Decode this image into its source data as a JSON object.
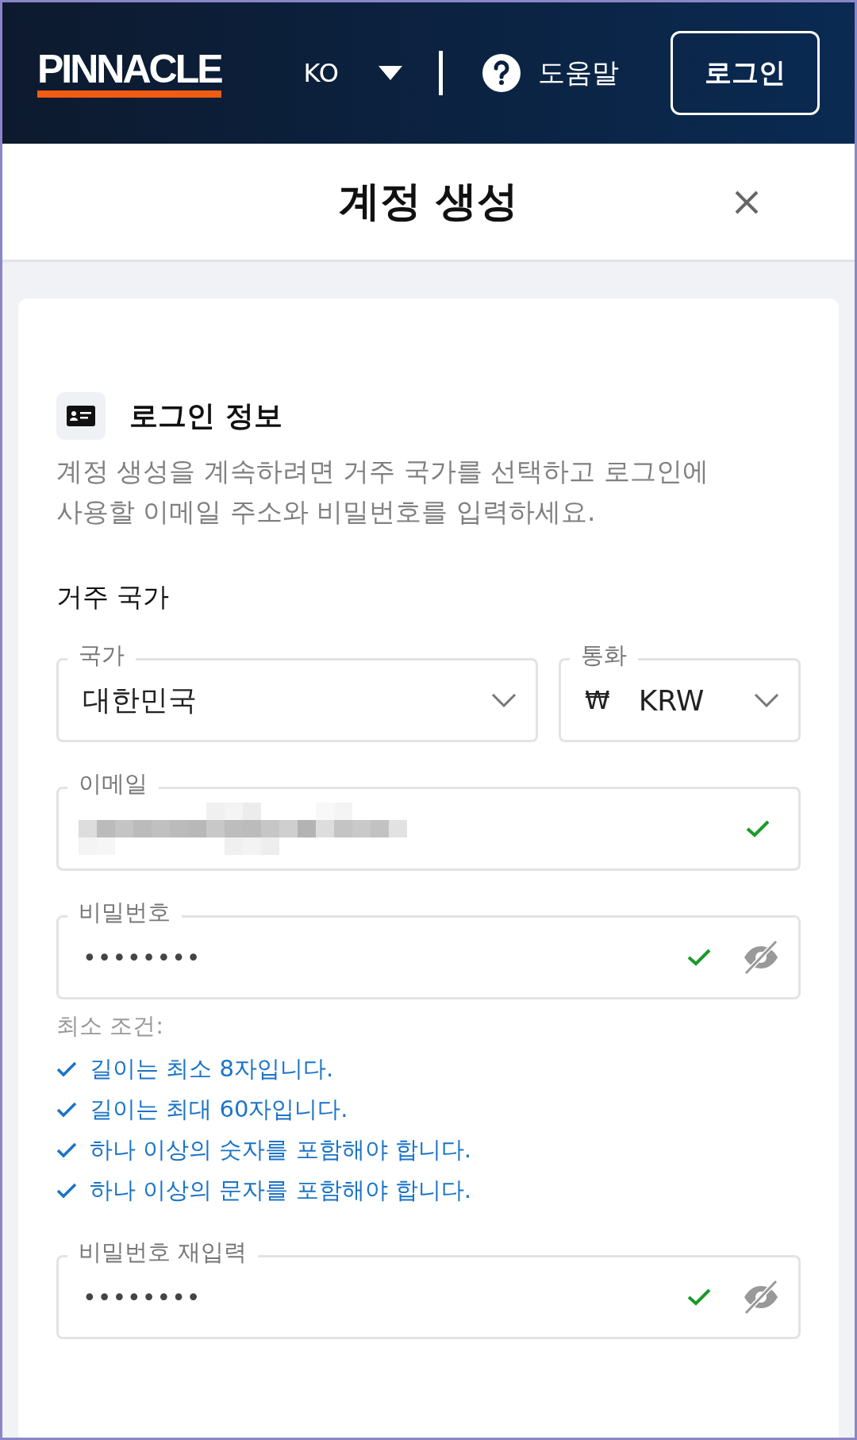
{
  "header": {
    "logo": "PINNACLE",
    "language": "KO",
    "help": "도움말",
    "login_button": "로그인"
  },
  "title_bar": {
    "title": "계정 생성"
  },
  "section": {
    "title": "로그인 정보",
    "description": "계정 생성을 계속하려면 거주 국가를 선택하고 로그인에 사용할 이메일 주소와 비밀번호를 입력하세요.",
    "subheading": "거주 국가"
  },
  "select_fields": [
    {
      "label": "국가",
      "value": "대한민국"
    },
    {
      "label": "통화",
      "symbol": "₩",
      "value": "KRW"
    }
  ],
  "email_field": {
    "label": "이메일",
    "value_redacted": true,
    "valid": true
  },
  "password_field": {
    "label": "비밀번호",
    "value": "••••••••",
    "valid": true,
    "masked": true
  },
  "requirements_title": "최소 조건:",
  "requirements": [
    {
      "text": "길이는 최소 8자입니다.",
      "met": true
    },
    {
      "text": "길이는 최대 60자입니다.",
      "met": true
    },
    {
      "text": "하나 이상의 숫자를 포함해야 합니다.",
      "met": true
    },
    {
      "text": "하나 이상의 문자를 포함해야 합니다.",
      "met": true
    }
  ],
  "confirm_field": {
    "label": "비밀번호 재입력",
    "value": "••••••••",
    "valid": true,
    "masked": true
  }
}
